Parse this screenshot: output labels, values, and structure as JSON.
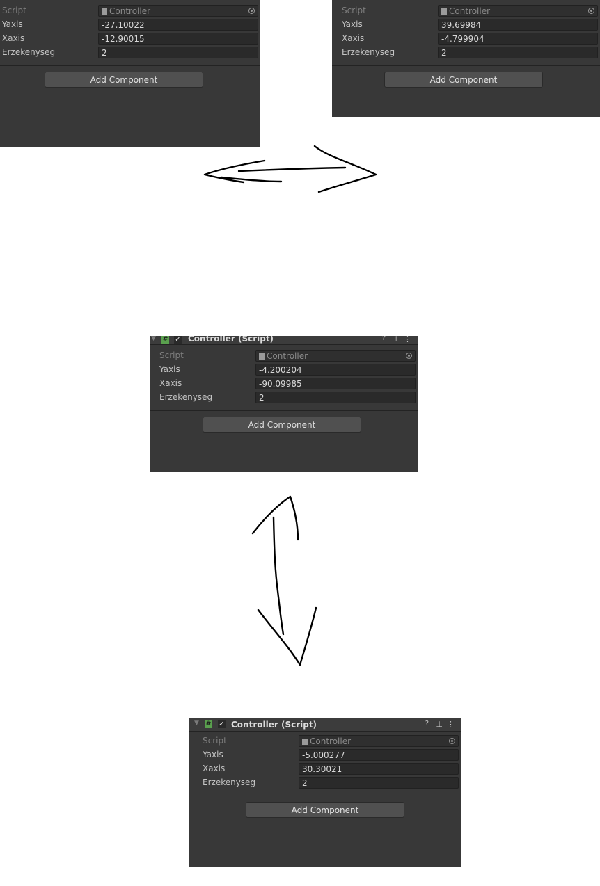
{
  "panels": [
    {
      "rows": [
        {
          "label": "Script",
          "value": "Controller"
        },
        {
          "label": "Yaxis",
          "value": "-27.10022"
        },
        {
          "label": "Xaxis",
          "value": "-12.90015"
        },
        {
          "label": "Erzekenyseg",
          "value": "2"
        }
      ],
      "add_component": "Add Component"
    },
    {
      "rows": [
        {
          "label": "Script",
          "value": "Controller"
        },
        {
          "label": "Yaxis",
          "value": "39.69984"
        },
        {
          "label": "Xaxis",
          "value": "-4.799904"
        },
        {
          "label": "Erzekenyseg",
          "value": "2"
        }
      ],
      "add_component": "Add Component"
    },
    {
      "header": {
        "title": "Controller (Script)",
        "hash_icon": "#",
        "check_icon": "✓",
        "help_icon": "?",
        "preset_icon": "⊥",
        "more_icon": "⋮"
      },
      "rows": [
        {
          "label": "Script",
          "value": "Controller"
        },
        {
          "label": "Yaxis",
          "value": "-4.200204"
        },
        {
          "label": "Xaxis",
          "value": "-90.09985"
        },
        {
          "label": "Erzekenyseg",
          "value": "2"
        }
      ],
      "add_component": "Add Component"
    },
    {
      "header": {
        "title": "Controller (Script)",
        "hash_icon": "#",
        "check_icon": "✓",
        "help_icon": "?",
        "preset_icon": "⊥",
        "more_icon": "⋮"
      },
      "rows": [
        {
          "label": "Script",
          "value": "Controller"
        },
        {
          "label": "Yaxis",
          "value": "-5.000277"
        },
        {
          "label": "Xaxis",
          "value": "30.30021"
        },
        {
          "label": "Erzekenyseg",
          "value": "2"
        }
      ],
      "add_component": "Add Component"
    }
  ],
  "drawings": [
    "horizontal-double-arrow",
    "vertical-double-arrow"
  ]
}
